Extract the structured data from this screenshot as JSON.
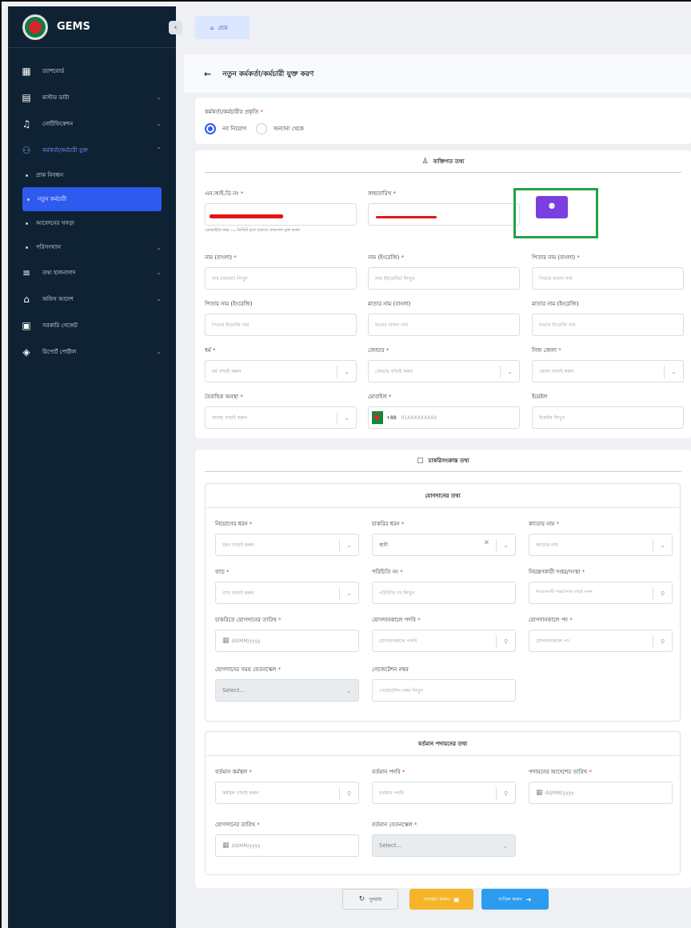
{
  "app": {
    "name": "GEMS"
  },
  "sidebar": {
    "items": [
      {
        "label": "ড্যাশবোর্ড",
        "icon": "dashboard-icon"
      },
      {
        "label": "মাস্টার ডাটা",
        "icon": "database-icon"
      },
      {
        "label": "নোটিফিকেশন",
        "icon": "bell-icon"
      },
      {
        "label": "কর্মকর্তা/কর্মচারী যুক্ত",
        "icon": "add-user-icon"
      },
      {
        "label": "তথ্য হালনাগাদ",
        "icon": "edit-list-icon"
      },
      {
        "label": "অফিস আদেশ",
        "icon": "bank-icon"
      },
      {
        "label": "সরকারি গেজেট",
        "icon": "gazette-icon"
      },
      {
        "label": "রিপোর্ট পোর্টাল",
        "icon": "report-icon"
      }
    ],
    "subitems": [
      {
        "label": "প্রাক নিবন্ধন"
      },
      {
        "label": "নতুন কর্মচারী"
      },
      {
        "label": "আবেদনের খসড়া"
      },
      {
        "label": "পরিসংখ্যান"
      }
    ]
  },
  "breadcrumb": {
    "home": "হোম"
  },
  "page": {
    "title": "নতুন কর্মকর্তা/কর্মচারী যুক্ত করণ"
  },
  "nature": {
    "label": "কর্মকর্তা/কর্মচারীর প্রকৃতি",
    "options": [
      "নব নিয়োগ",
      "অন্যান্য থেকে"
    ]
  },
  "personal": {
    "title": "ব্যক্তিগত তথ্য",
    "nid": {
      "label": "এন.আই.ডি নং",
      "hint": "এনআইডি নম্বর ১০ ডিজিট হলে শুরুতে জন্মসাল যুক্ত করুন"
    },
    "dob": {
      "label": "জন্মতারিখ"
    },
    "name_bn": {
      "label": "নাম (বাংলা)",
      "placeholder": "নাম (বাংলা) লিখুন"
    },
    "name_en": {
      "label": "নাম (ইংরেজি)",
      "placeholder": "নাম (ইংরেজি) লিখুন"
    },
    "father_bn": {
      "label": "পিতার নাম (বাংলা)",
      "placeholder": "পিতার বাংলা নাম"
    },
    "father_en": {
      "label": "পিতার নাম (ইংরেজি)",
      "placeholder": "পিতার ইংরেজি নাম"
    },
    "mother_bn": {
      "label": "মাতার নাম (বাংলা)",
      "placeholder": "মাতার বাংলা নাম"
    },
    "mother_en": {
      "label": "মাতার নাম (ইংরেজি)",
      "placeholder": "মাতার ইংরেজি নাম"
    },
    "religion": {
      "label": "ধর্ম",
      "placeholder": "ধর্ম বাছাই করুন"
    },
    "gender": {
      "label": "জেন্ডার",
      "placeholder": "জেন্ডার বাছাই করুন"
    },
    "district": {
      "label": "নিজ জেলা",
      "placeholder": "জেলা বাছাই করুন"
    },
    "marital": {
      "label": "বৈবাহিক অবস্থা",
      "placeholder": "অবস্থা বাছাই করুন"
    },
    "mobile": {
      "label": "মোবাইল",
      "code": "+88",
      "placeholder": "01XXXXXXXXX"
    },
    "email": {
      "label": "ইমেইল",
      "placeholder": "ইমেইল লিখুন"
    }
  },
  "job": {
    "title": "চাকরিসংক্রান্ত তথ্য",
    "joining": {
      "title": "যোগদানের তথ্য",
      "appoint_type": {
        "label": "নিয়োগের ধরন",
        "placeholder": "ধরন বাছাই করুন"
      },
      "job_type": {
        "label": "চাকরির ধরন",
        "value": "স্থায়ী"
      },
      "cadre": {
        "label": "ক্যাডার নাম",
        "placeholder": "ক্যাডার নাম"
      },
      "batch": {
        "label": "ব্যাচ",
        "placeholder": "ব্যাচ বাছাই করুন"
      },
      "id_no": {
        "label": "পরিচিতি নং",
        "placeholder": "পরিচিতি নং লিখুন"
      },
      "controller": {
        "label": "নিয়ন্ত্রণকারী দপ্তর/সংস্থা",
        "placeholder": "নিয়ন্ত্রণকারী দপ্তর/সংস্থা বাছাই করুন"
      },
      "join_date": {
        "label": "চাকরিতে যোগদানের তারিখ",
        "placeholder": "dd/MM/yyyy"
      },
      "join_post": {
        "label": "যোগদানকালে পদবি",
        "placeholder": "যোগদানকালে পদবি"
      },
      "join_rank": {
        "label": "যোগদানকালে পদ",
        "placeholder": "যোগদানকালে পদ"
      },
      "pay_scale": {
        "label": "যোগদানের সময় বেতনস্কেল",
        "placeholder": "Select..."
      },
      "gazette_no": {
        "label": "গেজেটেশন নম্বর",
        "placeholder": "গেজেটেশন নম্বর লিখুন"
      }
    },
    "current": {
      "title": "বর্তমান পদায়নের তথ্য",
      "workplace": {
        "label": "বর্তমান কর্মস্থল",
        "placeholder": "কর্মস্থল বাছাই করুন"
      },
      "designation": {
        "label": "বর্তমান পদবি",
        "placeholder": "বর্তমান পদবি"
      },
      "order_date": {
        "label": "পদায়নের আদেশের তারিখ",
        "placeholder": "dd/MM/yyyy"
      },
      "joining_date": {
        "label": "যোগদানের তারিখ",
        "placeholder": "dd/MM/yyyy"
      },
      "pay_scale": {
        "label": "বর্তমান বেতনস্কেল",
        "placeholder": "Select..."
      }
    }
  },
  "actions": {
    "reset": "পুনরায়",
    "save": "সংরক্ষণ করুন",
    "submit": "দাখিল করুন"
  },
  "colors": {
    "sidebar": "#0f2233",
    "primary": "#2f5af0",
    "face_button": "#7a3fe0",
    "highlight": "#21a348",
    "save": "#f4b52a",
    "submit": "#2b9cf0"
  }
}
